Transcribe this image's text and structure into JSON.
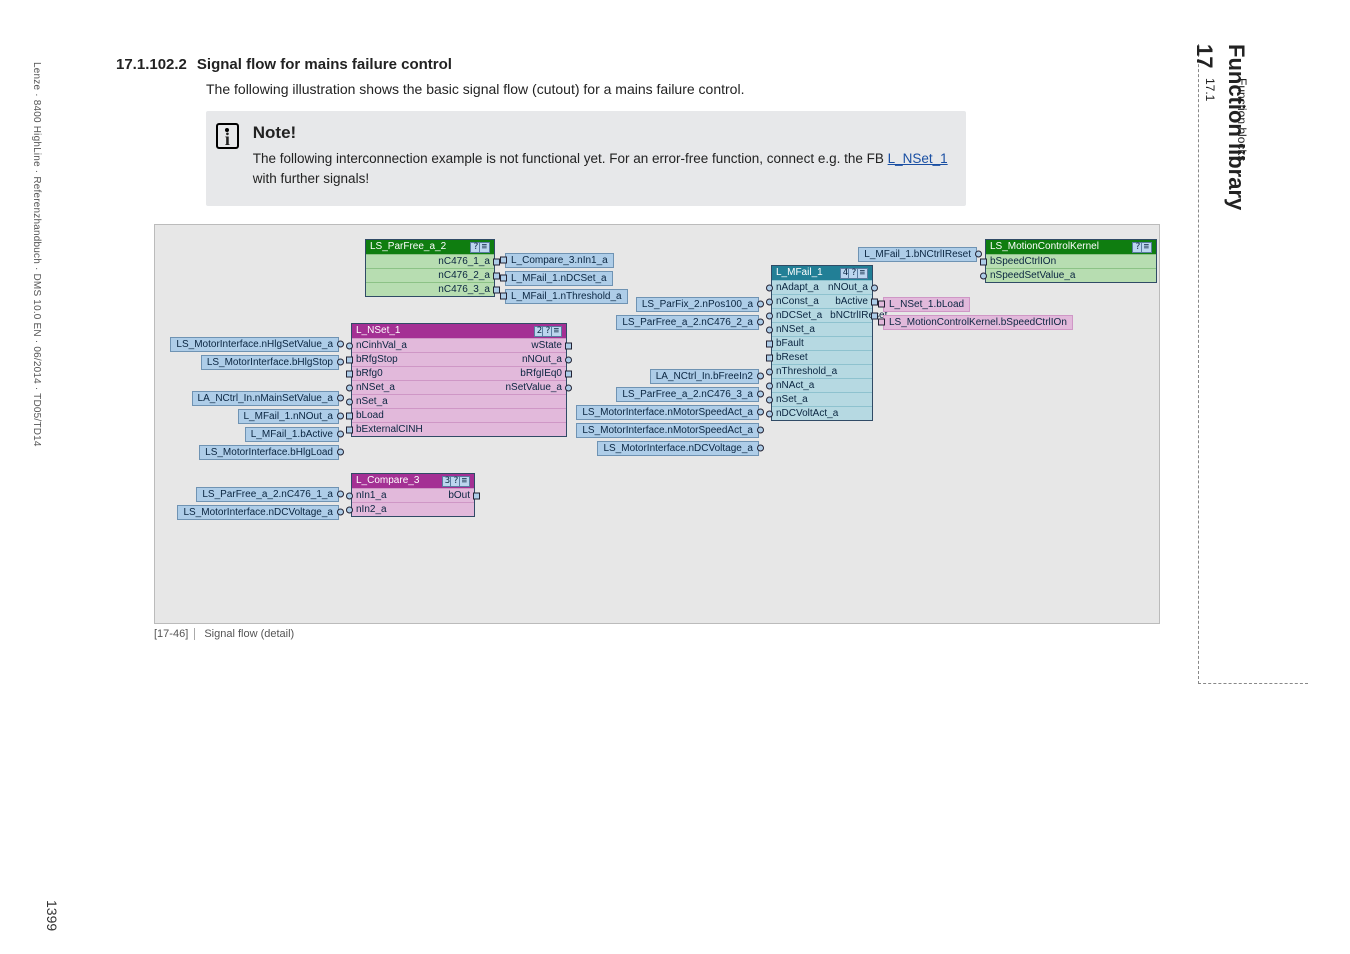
{
  "footer_text": "Lenze · 8400 HighLine · Referenzhandbuch · DMS 10.0 EN · 06/2014 · TD05/TD14",
  "page_number": "1399",
  "right": {
    "chapnum": "17",
    "chaptitle": "Function library",
    "subnum": "17.1",
    "subtitle": "Function blocks"
  },
  "section": {
    "num": "17.1.102.2",
    "title": "Signal flow for mains failure control"
  },
  "intro": "The following illustration shows the basic signal flow (cutout) for a mains failure control.",
  "note": {
    "heading": "Note!",
    "body_a": "The following interconnection example is not functional yet. For an error-free function, connect e.g. the FB ",
    "link": "L_NSet_1",
    "body_b": " with further signals!"
  },
  "figcap": {
    "label": "[17-46]",
    "text": "Signal flow (detail)"
  },
  "parfree": {
    "title": "LS_ParFree_a_2",
    "b1": "?",
    "b2": "≡",
    "rows": [
      "nC476_1_a",
      "nC476_2_a",
      "nC476_3_a"
    ]
  },
  "parfree_dst": [
    "L_Compare_3.nIn1_a",
    "L_MFail_1.nDCSet_a",
    "L_MFail_1.nThreshold_a"
  ],
  "nset": {
    "title": "L_NSet_1",
    "b1": "2",
    "b2": "?",
    "b3": "≡",
    "rowsL": [
      "nCinhVal_a",
      "bRfgStop",
      "bRfg0",
      "nNSet_a",
      "nSet_a",
      "bLoad",
      "bExternalCINH"
    ],
    "rowsR": [
      "wState",
      "nNOut_a",
      "bRfgIEq0",
      "nSetValue_a"
    ]
  },
  "nset_src": [
    "LS_MotorInterface.nHlgSetValue_a",
    "LS_MotorInterface.bHlgStop",
    "",
    "LA_NCtrl_In.nMainSetValue_a",
    "L_MFail_1.nNOut_a",
    "L_MFail_1.bActive",
    "LS_MotorInterface.bHlgLoad"
  ],
  "compare": {
    "title": "L_Compare_3",
    "b1": "3",
    "b2": "?",
    "b3": "≡",
    "rowsL": [
      "nIn1_a",
      "nIn2_a"
    ],
    "rowR": "bOut"
  },
  "compare_src": [
    "LS_ParFree_a_2.nC476_1_a",
    "LS_MotorInterface.nDCVoltage_a"
  ],
  "mfail": {
    "title": "L_MFail_1",
    "b1": "4",
    "b2": "?",
    "b3": "≡",
    "rowsL": [
      "nAdapt_a",
      "nConst_a",
      "nDCSet_a",
      "nNSet_a",
      "bFault",
      "bReset",
      "nThreshold_a",
      "nNAct_a",
      "nSet_a",
      "nDCVoltAct_a"
    ],
    "rowsR": [
      "nNOut_a",
      "bActive",
      "bNCtrlIReset"
    ]
  },
  "mfail_src": [
    "",
    "LS_ParFix_2.nPos100_a",
    "LS_ParFree_a_2.nC476_2_a",
    "",
    "",
    "LA_NCtrl_In.bFreeIn2",
    "LS_ParFree_a_2.nC476_3_a",
    "LS_MotorInterface.nMotorSpeedAct_a",
    "LS_MotorInterface.nMotorSpeedAct_a",
    "LS_MotorInterface.nDCVoltage_a"
  ],
  "mfail_dstR": [
    "",
    "L_NSet_1.bLoad",
    "LS_MotionControlKernel.bSpeedCtrlIOn"
  ],
  "mfail_topdst": "L_MFail_1.bNCtrlIReset",
  "mck": {
    "title": "LS_MotionControlKernel",
    "b1": "?",
    "b2": "≡",
    "rows": [
      "bSpeedCtrlIOn",
      "nSpeedSetValue_a"
    ]
  }
}
